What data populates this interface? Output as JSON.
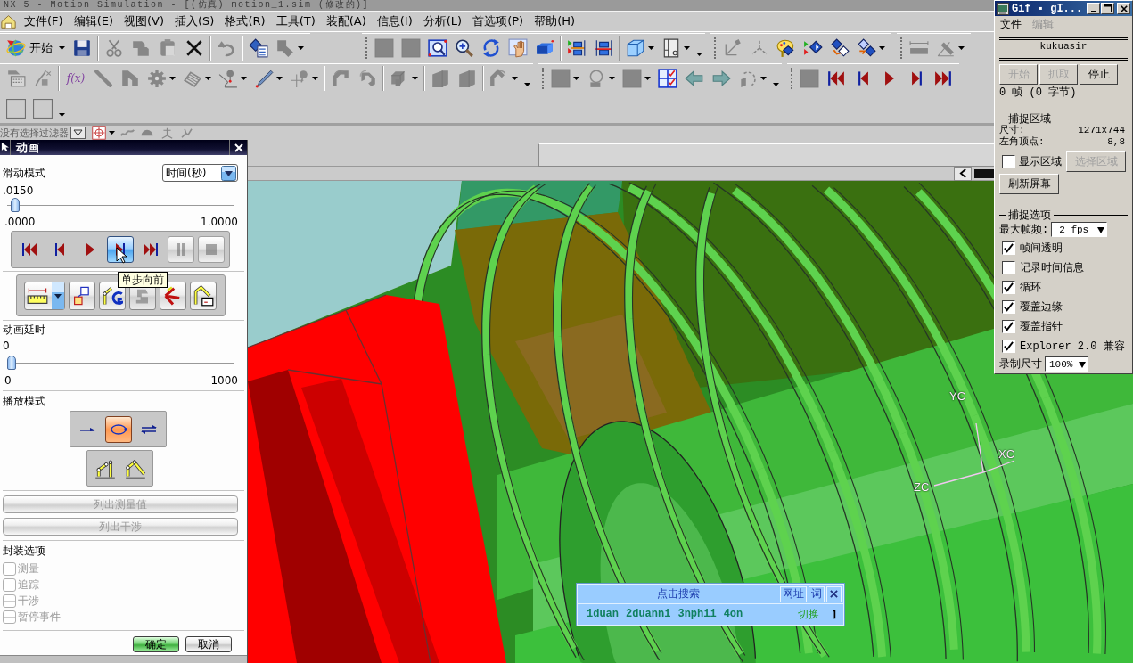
{
  "window": {
    "title": "NX 5 - Motion Simulation - [(仿真) motion_1.sim (修改的)]"
  },
  "menu": [
    "文件(F)",
    "编辑(E)",
    "视图(V)",
    "插入(S)",
    "格式(R)",
    "工具(T)",
    "装配(A)",
    "信息(I)",
    "分析(L)",
    "首选项(P)",
    "帮助(H)"
  ],
  "toolbar_rows": [
    {
      "toolbars": [
        {
          "grip": false,
          "more": false,
          "items": [
            {
              "kind": "start",
              "label": "开始",
              "dropdown": true,
              "disabled": false
            },
            {
              "kind": "save",
              "dropdown": false,
              "disabled": false
            },
            {
              "kind": "separator"
            },
            {
              "kind": "cut",
              "dropdown": false,
              "disabled": true
            },
            {
              "kind": "copy",
              "dropdown": false,
              "disabled": true
            },
            {
              "kind": "paste",
              "dropdown": false,
              "disabled": true
            },
            {
              "kind": "delete",
              "dropdown": false,
              "disabled": false
            },
            {
              "kind": "separator"
            },
            {
              "kind": "undo",
              "dropdown": false,
              "disabled": true
            },
            {
              "kind": "separator"
            },
            {
              "kind": "props",
              "dropdown": false,
              "disabled": false
            },
            {
              "kind": "shape",
              "dropdown": true,
              "disabled": true
            }
          ]
        },
        {
          "grip": true,
          "more": true,
          "items": [
            {
              "kind": "square",
              "dropdown": false,
              "disabled": true
            },
            {
              "kind": "square",
              "dropdown": false,
              "disabled": true
            },
            {
              "kind": "zoomfit",
              "dropdown": false,
              "disabled": false
            },
            {
              "kind": "zoom",
              "dropdown": false,
              "disabled": false
            },
            {
              "kind": "rotate",
              "dropdown": false,
              "disabled": false
            },
            {
              "kind": "pan",
              "dropdown": false,
              "disabled": false
            },
            {
              "kind": "block",
              "dropdown": false,
              "disabled": false
            },
            {
              "kind": "separator"
            },
            {
              "kind": "motion",
              "dropdown": false,
              "disabled": false
            },
            {
              "kind": "motion2",
              "dropdown": false,
              "disabled": false
            },
            {
              "kind": "separator"
            },
            {
              "kind": "cube",
              "dropdown": true,
              "disabled": false
            },
            {
              "kind": "sheet",
              "dropdown": true,
              "disabled": false
            }
          ]
        },
        {
          "grip": true,
          "more": false,
          "items": [
            {
              "kind": "vector",
              "dropdown": false,
              "disabled": true
            },
            {
              "kind": "axes",
              "dropdown": false,
              "disabled": true
            },
            {
              "kind": "palette",
              "dropdown": false,
              "disabled": false
            },
            {
              "kind": "diamondplay",
              "dropdown": false,
              "disabled": false
            },
            {
              "kind": "diamondswap",
              "dropdown": false,
              "disabled": false
            },
            {
              "kind": "diamondpair",
              "dropdown": true,
              "disabled": false
            }
          ]
        },
        {
          "grip": true,
          "more": false,
          "items": [
            {
              "kind": "distance",
              "dropdown": false,
              "disabled": true
            },
            {
              "kind": "angle",
              "dropdown": true,
              "disabled": true
            }
          ]
        }
      ]
    },
    {
      "toolbars": [
        {
          "grip": false,
          "more": true,
          "items": [
            {
              "kind": "keyboard",
              "dropdown": false,
              "disabled": true
            },
            {
              "kind": "curveedit",
              "dropdown": false,
              "disabled": true
            },
            {
              "kind": "separator"
            },
            {
              "kind": "text",
              "label": "f(x)",
              "dropdown": false,
              "disabled": false
            },
            {
              "kind": "line",
              "dropdown": false,
              "disabled": true
            },
            {
              "kind": "bracket",
              "dropdown": false,
              "disabled": true
            },
            {
              "kind": "gear",
              "dropdown": true,
              "disabled": true
            },
            {
              "kind": "spring",
              "dropdown": true,
              "disabled": true
            },
            {
              "kind": "curvepin",
              "dropdown": true,
              "disabled": false
            },
            {
              "kind": "pen",
              "dropdown": true,
              "disabled": false
            },
            {
              "kind": "crosspin",
              "dropdown": true,
              "disabled": true
            },
            {
              "kind": "separator"
            },
            {
              "kind": "bend",
              "dropdown": false,
              "disabled": true
            },
            {
              "kind": "hook",
              "dropdown": false,
              "disabled": true
            },
            {
              "kind": "separator"
            },
            {
              "kind": "block3d",
              "dropdown": true,
              "disabled": true
            },
            {
              "kind": "separator"
            },
            {
              "kind": "slab",
              "dropdown": false,
              "disabled": true
            },
            {
              "kind": "slab",
              "dropdown": false,
              "disabled": true
            },
            {
              "kind": "separator"
            },
            {
              "kind": "arcarrow",
              "dropdown": true,
              "disabled": true
            }
          ]
        },
        {
          "grip": true,
          "more": true,
          "items": [
            {
              "kind": "square",
              "dropdown": true,
              "disabled": true
            },
            {
              "kind": "circlepin",
              "dropdown": true,
              "disabled": true
            },
            {
              "kind": "square",
              "dropdown": true,
              "disabled": true
            },
            {
              "kind": "checklist",
              "dropdown": false,
              "disabled": false
            },
            {
              "kind": "arrowleft",
              "dropdown": false,
              "disabled": false
            },
            {
              "kind": "arrowright",
              "dropdown": false,
              "disabled": false
            },
            {
              "kind": "rotateback",
              "dropdown": true,
              "disabled": true
            }
          ]
        },
        {
          "grip": true,
          "more": false,
          "items": [
            {
              "kind": "square",
              "dropdown": false,
              "disabled": true
            },
            {
              "kind": "rewind",
              "dropdown": false,
              "disabled": false
            },
            {
              "kind": "stepback",
              "dropdown": false,
              "disabled": false
            },
            {
              "kind": "play",
              "dropdown": false,
              "disabled": false
            },
            {
              "kind": "stepfwd",
              "dropdown": false,
              "disabled": false
            },
            {
              "kind": "ff",
              "dropdown": false,
              "disabled": false
            }
          ]
        }
      ]
    },
    {
      "toolbars": [
        {
          "grip": false,
          "more": true,
          "items": [
            {
              "kind": "blank",
              "dropdown": false,
              "disabled": false
            },
            {
              "kind": "blank",
              "dropdown": false,
              "disabled": false
            }
          ]
        }
      ]
    }
  ],
  "selection_bar": {
    "filter": "没有选择过滤器",
    "tools": [
      {
        "kind": "crosshair",
        "dropdown": true,
        "disabled": false
      },
      {
        "kind": "wave",
        "dropdown": false,
        "disabled": true
      },
      {
        "kind": "dome",
        "dropdown": false,
        "disabled": true
      },
      {
        "kind": "tripod",
        "dropdown": false,
        "disabled": true
      },
      {
        "kind": "twig",
        "dropdown": false,
        "disabled": true
      }
    ]
  },
  "animation_dialog": {
    "title": "动画",
    "slider_mode": {
      "label": "滑动模式",
      "value": "时间(秒)"
    },
    "time": {
      "value": ".0150",
      "level": 0.015,
      "min": ".0000",
      "max": "1.0000"
    },
    "playback_buttons": [
      {
        "kind": "rewind",
        "selected": false,
        "disabled": false
      },
      {
        "kind": "stepback",
        "selected": false,
        "disabled": false
      },
      {
        "kind": "play",
        "selected": false,
        "disabled": false
      },
      {
        "kind": "stepfwd",
        "selected": true,
        "disabled": false
      },
      {
        "kind": "ff",
        "selected": false,
        "disabled": false
      },
      {
        "kind": "pause",
        "selected": false,
        "disabled": true
      },
      {
        "kind": "stop",
        "selected": false,
        "disabled": true
      }
    ],
    "tooltip": "单步向前",
    "tool_buttons": [
      {
        "kind": "measure",
        "dropdown": true,
        "disabled": false
      },
      {
        "kind": "boxpair",
        "dropdown": false,
        "disabled": false
      },
      {
        "kind": "armg",
        "dropdown": false,
        "disabled": false
      },
      {
        "kind": "armgray",
        "dropdown": false,
        "disabled": true
      },
      {
        "kind": "redarrows",
        "dropdown": false,
        "disabled": false
      },
      {
        "kind": "armbox",
        "dropdown": false,
        "disabled": false
      }
    ],
    "delay": {
      "label": "动画延时",
      "value": "0",
      "level": 0,
      "min": "0",
      "max": "1000"
    },
    "play_mode": {
      "label": "播放模式",
      "options": [
        {
          "kind": "once",
          "selected": false
        },
        {
          "kind": "loop",
          "selected": true
        },
        {
          "kind": "pingpong",
          "selected": false
        }
      ]
    },
    "arm_buttons": [
      {
        "kind": "link2"
      },
      {
        "kind": "fold"
      }
    ],
    "list_buttons": [
      {
        "label": "列出测量值",
        "disabled": true
      },
      {
        "label": "列出干涉",
        "disabled": true
      }
    ],
    "packaging": {
      "label": "封装选项",
      "items": [
        {
          "label": "测量",
          "checked": false,
          "disabled": true
        },
        {
          "label": "追踪",
          "checked": false,
          "disabled": true
        },
        {
          "label": "干涉",
          "checked": false,
          "disabled": true
        },
        {
          "label": "暂停事件",
          "checked": false,
          "disabled": true
        }
      ]
    },
    "buttons": [
      {
        "label": "确定",
        "default": true
      },
      {
        "label": "取消",
        "default": false
      }
    ]
  },
  "viewport": {
    "axis_labels": [
      "YC",
      "XC",
      "ZC"
    ]
  },
  "gif_window": {
    "title": "Gif ▪ gI...",
    "menu": [
      {
        "label": "文件",
        "disabled": false
      },
      {
        "label": "编辑",
        "disabled": true
      }
    ],
    "user": "kukuasir",
    "buttons": [
      {
        "label": "开始",
        "disabled": true
      },
      {
        "label": "抓取",
        "disabled": true
      },
      {
        "label": "停止",
        "disabled": false
      }
    ],
    "frames": "0 帧 (0 字节)",
    "capture_area": {
      "title": "捕捉区域",
      "fields": [
        {
          "label": "尺寸:",
          "value": "1271x744"
        },
        {
          "label": "左角顶点:",
          "value": "8,8"
        }
      ],
      "show_area": {
        "label": "显示区域",
        "checked": false
      },
      "select_button": {
        "label": "选择区域",
        "disabled": true
      },
      "refresh_button": "刷新屏幕"
    },
    "capture_options": {
      "title": "捕捉选项",
      "frame_rate": {
        "label": "最大帧频:",
        "value": "2 fps"
      },
      "checkboxes": [
        {
          "label": "帧间透明",
          "checked": true
        },
        {
          "label": "记录时间信息",
          "checked": false
        },
        {
          "label": "循环",
          "checked": true
        },
        {
          "label": "覆盖边缘",
          "checked": true
        },
        {
          "label": "覆盖指针",
          "checked": true
        },
        {
          "label": "Explorer 2.0 兼容",
          "checked": true
        }
      ],
      "size": {
        "label": "录制尺寸",
        "value": "100%"
      }
    }
  },
  "search_popup": {
    "title": "点击搜索",
    "buttons": [
      "网址",
      "词"
    ],
    "candidates": [
      "1duan",
      "2duanni",
      "3nphii",
      "4on"
    ],
    "switch": "切换",
    "extra": "]"
  }
}
